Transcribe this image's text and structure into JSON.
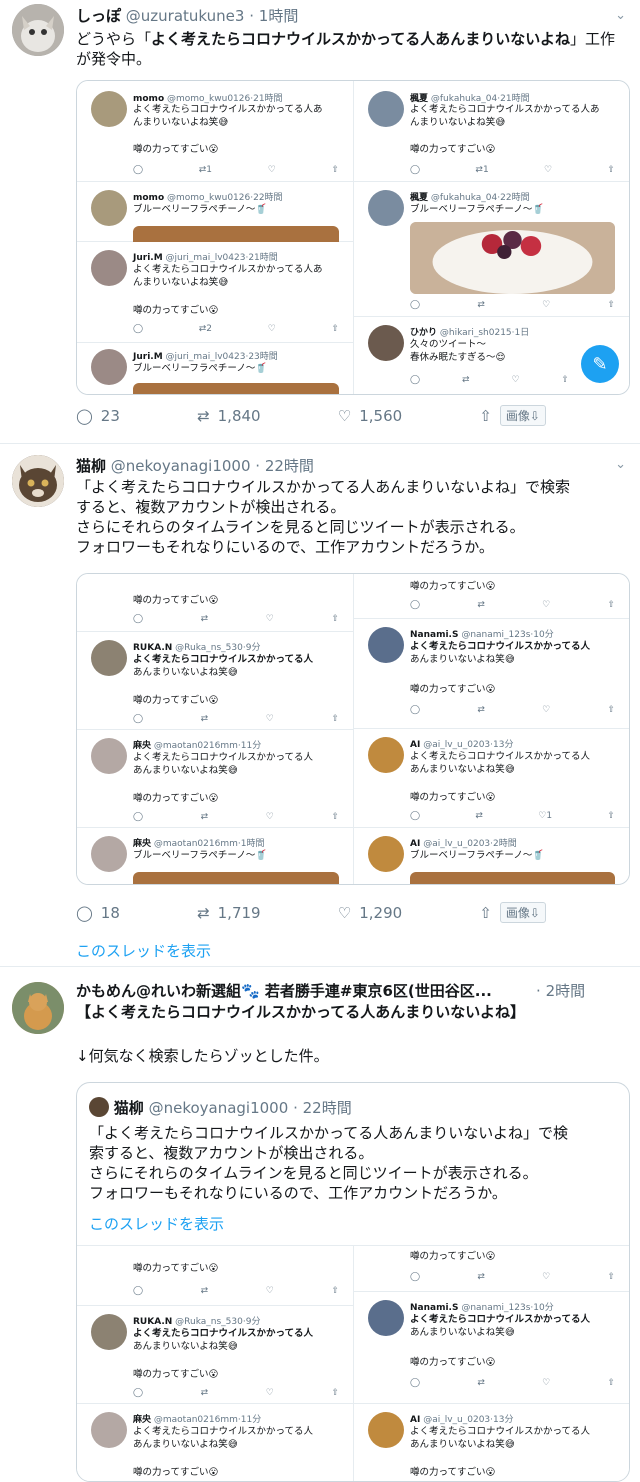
{
  "emoji": {
    "grin": "😅",
    "wow": "😮",
    "drink": "🥤",
    "smile": "😌"
  },
  "icons": {
    "reply": "reply-icon",
    "retweet": "retweet-icon",
    "like": "like-icon",
    "share": "share-icon",
    "compose": "compose-icon",
    "caret": "chevron-down-icon"
  },
  "colors": {
    "link": "#1da1f2",
    "muted": "#657786",
    "border": "#e6ecf0"
  },
  "t1": {
    "name": "しっぽ",
    "handle": "@uzuratukune3",
    "time": "1時間",
    "body_pre": "どうやら「",
    "body_bold": "よく考えたらコロナウイルスかかってる人あんまりいないよね",
    "body_post": "」工作が発令中。",
    "replies": "23",
    "retweets": "1,840",
    "likes": "1,560",
    "image_btn": "画像⇩",
    "left": [
      {
        "name": "momo",
        "handle": "@momo_kwu0126",
        "time": "21時間",
        "line1": "よく考えたらコロナウイルスかかってる人あ",
        "line2": "んまりいないよね笑",
        "line3": "噂の力ってすごい",
        "rt": "1",
        "lk": ""
      },
      {
        "name": "momo",
        "handle": "@momo_kwu0126",
        "time": "22時間",
        "line1": "ブルーベリーフラペチーノ〜"
      },
      {
        "name": "Juri.M",
        "handle": "@juri_mai_lv0423",
        "time": "21時間",
        "line1": "よく考えたらコロナウイルスかかってる人あ",
        "line2": "んまりいないよね笑",
        "line3": "噂の力ってすごい",
        "rt": "2",
        "lk": ""
      },
      {
        "name": "Juri.M",
        "handle": "@juri_mai_lv0423",
        "time": "23時間",
        "line1": "ブルーベリーフラペチーノ〜"
      }
    ],
    "right": [
      {
        "name": "楓夏",
        "handle": "@fukahuka_04",
        "time": "21時間",
        "line1": "よく考えたらコロナウイルスかかってる人あ",
        "line2": "んまりいないよね笑",
        "line3": "噂の力ってすごい",
        "rt": "1",
        "lk": ""
      },
      {
        "name": "楓夏",
        "handle": "@fukahuka_04",
        "time": "22時間",
        "line1": "ブルーベリーフラペチーノ〜"
      },
      {
        "name": "ひかり",
        "handle": "@hikari_sh0215",
        "time": "1日",
        "line1": "久々のツイート〜",
        "line2": "春休み眠たすぎる〜"
      }
    ]
  },
  "t2": {
    "name": "猫柳",
    "handle": "@nekoyanagi1000",
    "time": "22時間",
    "line1": "「よく考えたらコロナウイルスかかってる人あんまりいないよね」で検索",
    "line2": "すると、複数アカウントが検出される。",
    "line3": "さらにそれらのタイムラインを見ると同じツイートが表示される。",
    "line4": "フォロワーもそれなりにいるので、工作アカウントだろうか。",
    "replies": "18",
    "retweets": "1,719",
    "likes": "1,290",
    "image_btn": "画像⇩",
    "thread_link": "このスレッドを表示",
    "left": [
      {
        "line3": "噂の力ってすごい"
      },
      {
        "name": "RUKA.N",
        "handle": "@Ruka_ns_530",
        "time": "9分",
        "line1": "よく考えたらコロナウイルスかかってる人",
        "line2": "あんまりいないよね笑",
        "line3": "噂の力ってすごい"
      },
      {
        "name": "麻央",
        "handle": "@maotan0216mm",
        "time": "11分",
        "line1": "よく考えたらコロナウイルスかかってる人",
        "line2": "あんまりいないよね笑",
        "line3": "噂の力ってすごい"
      },
      {
        "name": "麻央",
        "handle": "@maotan0216mm",
        "time": "1時間",
        "line1": "ブルーベリーフラペチーノ〜"
      }
    ],
    "right": [
      {
        "line3": "噂の力ってすごい"
      },
      {
        "name": "Nanami.S",
        "handle": "@nanami_123s",
        "time": "10分",
        "line1": "よく考えたらコロナウイルスかかってる人",
        "line2": "あんまりいないよね笑",
        "line3": "噂の力ってすごい"
      },
      {
        "name": "AI",
        "handle": "@ai_lv_u_0203",
        "time": "13分",
        "line1": "よく考えたらコロナウイルスかかってる人",
        "line2": "あんまりいないよね笑",
        "line3": "噂の力ってすごい",
        "rt": "",
        "lk": "1"
      },
      {
        "name": "AI",
        "handle": "@ai_lv_u_0203",
        "time": "2時間",
        "line1": "ブルーベリーフラペチーノ〜"
      }
    ]
  },
  "t3": {
    "name": "かもめん@れいわ新選組🐾 若者勝手連#東京6区(世田谷区...",
    "time": "2時間",
    "heading": "【よく考えたらコロナウイルスかかってる人あんまりいないよね】",
    "body": "↓何気なく検索したらゾッとした件。",
    "quote": {
      "name": "猫柳",
      "handle": "@nekoyanagi1000",
      "time": "22時間",
      "line1": "「よく考えたらコロナウイルスかかってる人あんまりいないよね」で検",
      "line2": "索すると、複数アカウントが検出される。",
      "line3": "さらにそれらのタイムラインを見ると同じツイートが表示される。",
      "line4": "フォロワーもそれなりにいるので、工作アカウントだろうか。",
      "thread_link": "このスレッドを表示"
    }
  }
}
